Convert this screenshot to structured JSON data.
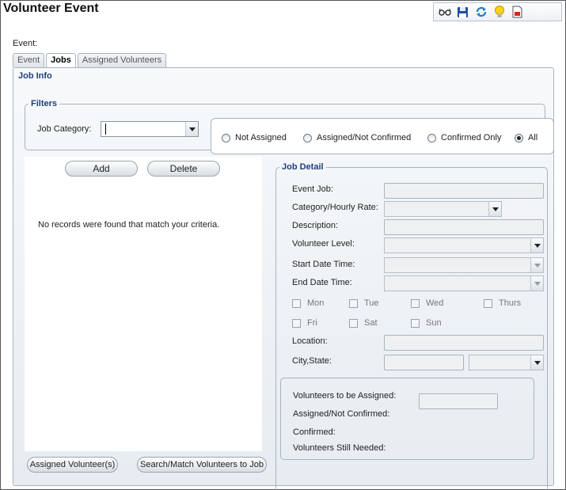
{
  "window": {
    "title": "Volunteer Event"
  },
  "toolbar": {
    "icons": [
      "glasses-icon",
      "save-icon",
      "refresh-icon",
      "lightbulb-icon",
      "report-icon"
    ]
  },
  "event_label": "Event:",
  "tabs": [
    {
      "label": "Event",
      "active": false
    },
    {
      "label": "Jobs",
      "active": true
    },
    {
      "label": "Assigned Volunteers",
      "active": false
    }
  ],
  "job_info": {
    "legend": "Job Info",
    "filters": {
      "legend": "Filters",
      "job_category_label": "Job Category:",
      "job_category_value": "",
      "radios": [
        {
          "label": "Not Assigned",
          "checked": false
        },
        {
          "label": "Assigned/Not Confirmed",
          "checked": false
        },
        {
          "label": "Confirmed Only",
          "checked": false
        },
        {
          "label": "All",
          "checked": true
        }
      ]
    },
    "list": {
      "add_label": "Add",
      "delete_label": "Delete",
      "empty_message": "No records were found that match your criteria.",
      "assigned_btn": "Assigned Volunteer(s)",
      "search_btn": "Search/Match Volunteers to Job"
    },
    "detail": {
      "legend": "Job Detail",
      "event_job": "Event Job:",
      "category_rate": "Category/Hourly Rate:",
      "description": "Description:",
      "volunteer_level": "Volunteer Level:",
      "start_dt": "Start Date Time:",
      "end_dt": "End Date Time:",
      "days": [
        "Mon",
        "Tue",
        "Wed",
        "Thurs",
        "Fri",
        "Sat",
        "Sun"
      ],
      "location": "Location:",
      "city_state": "City,State:",
      "counts": {
        "to_be_assigned": "Volunteers to be Assigned:",
        "assigned_not_confirmed": "Assigned/Not Confirmed:",
        "confirmed": "Confirmed:",
        "still_needed": "Volunteers Still Needed:"
      }
    }
  }
}
